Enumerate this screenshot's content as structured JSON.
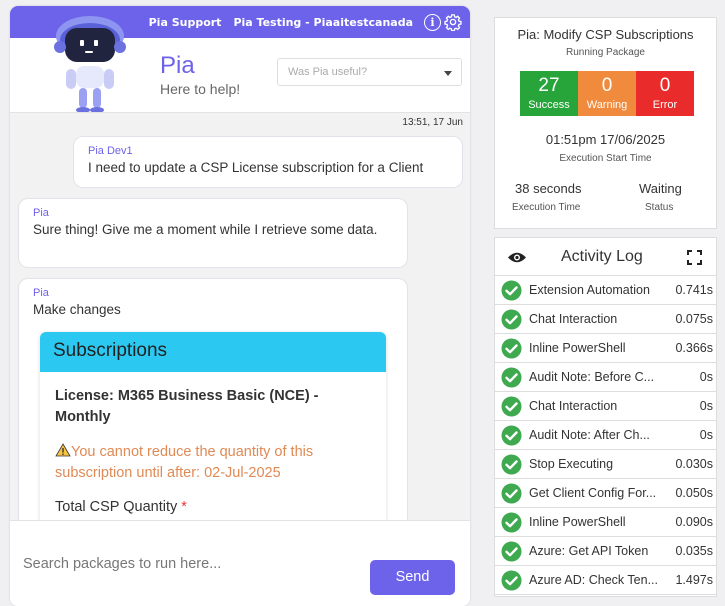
{
  "header": {
    "support_link": "Pia Support",
    "tenant_link": "Pia Testing - Piaaitestcanada",
    "info_icon": "info-icon",
    "settings_icon": "gear-icon"
  },
  "assistant": {
    "name": "Pia",
    "tagline": "Here to help!",
    "feedback_placeholder": "Was Pia useful?"
  },
  "chat": {
    "timestamp": "13:51, 17 Jun",
    "messages": [
      {
        "sender": "Pia Dev1",
        "text": "I need to update a CSP License subscription for a Client"
      },
      {
        "sender": "Pia",
        "text": "Sure thing! Give me a moment while I retrieve some data."
      },
      {
        "sender": "Pia",
        "text": "Make changes"
      }
    ],
    "subscriptions_card": {
      "title": "Subscriptions",
      "license": "License: M365 Business Basic (NCE) - Monthly",
      "warning": "You cannot reduce the quantity of this subscription until after: 02-Jul-2025",
      "field_label": "Total CSP Quantity",
      "required_mark": "*"
    }
  },
  "composer": {
    "placeholder": "Search packages to run here...",
    "send_label": "Send"
  },
  "status": {
    "title": "Pia: Modify CSP Subscriptions",
    "subtitle": "Running Package",
    "success_count": "27",
    "success_label": "Success",
    "warning_count": "0",
    "warning_label": "Warning",
    "error_count": "0",
    "error_label": "Error",
    "start_time": "01:51pm 17/06/2025",
    "start_label": "Execution Start Time",
    "exec_time": "38 seconds",
    "exec_label": "Execution Time",
    "status_value": "Waiting",
    "status_label": "Status",
    "colors": {
      "success": "#27a53b",
      "warning": "#f08a3c",
      "error": "#ea2b2b"
    }
  },
  "activity": {
    "title": "Activity Log",
    "items": [
      {
        "name": "Extension Automation",
        "duration": "0.741s"
      },
      {
        "name": "Chat Interaction",
        "duration": "0.075s"
      },
      {
        "name": "Inline PowerShell",
        "duration": "0.366s"
      },
      {
        "name": "Audit Note: Before C...",
        "duration": "0s"
      },
      {
        "name": "Chat Interaction",
        "duration": "0s"
      },
      {
        "name": "Audit Note: After Ch...",
        "duration": "0s"
      },
      {
        "name": "Stop Executing",
        "duration": "0.030s"
      },
      {
        "name": "Get Client Config For...",
        "duration": "0.050s"
      },
      {
        "name": "Inline PowerShell",
        "duration": "0.090s"
      },
      {
        "name": "Azure: Get API Token",
        "duration": "0.035s"
      },
      {
        "name": "Azure AD: Check Ten...",
        "duration": "1.497s"
      }
    ]
  },
  "theme": {
    "accent": "#6d63ea",
    "card_header": "#2bc9f2",
    "check": "#3ea94f"
  }
}
